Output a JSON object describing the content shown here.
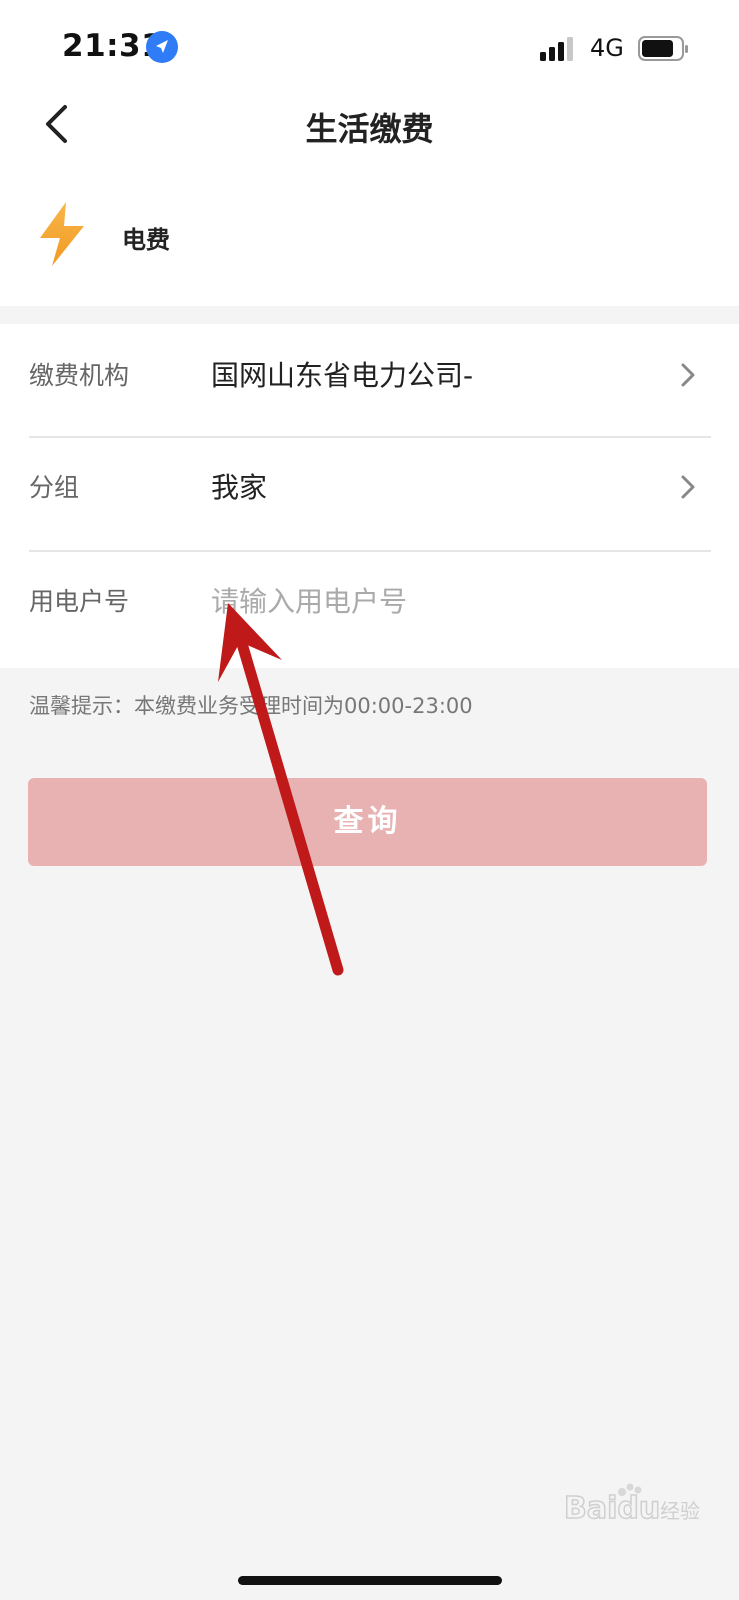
{
  "status_bar": {
    "time": "21:31",
    "network": "4G",
    "icons": [
      "location-arrow-icon",
      "signal-icon",
      "battery-icon"
    ]
  },
  "nav": {
    "title": "生活缴费",
    "back_icon": "chevron-left-icon"
  },
  "service": {
    "icon": "lightning-bolt-icon",
    "name": "电费"
  },
  "form": {
    "rows": [
      {
        "label": "缴费机构",
        "value": "国网山东省电力公司-"
      },
      {
        "label": "分组",
        "value": "我家"
      },
      {
        "label": "用电户号",
        "placeholder": "请输入用电户号"
      }
    ]
  },
  "tip": "温馨提示：本缴费业务受理时间为00:00-23:00",
  "query_button": {
    "label": "查询",
    "color": "#e8b2b3"
  },
  "watermark_text": "Baidu 经验",
  "colors": {
    "accent_orange": "#f5a623",
    "arrow_red": "#c0191a",
    "location_blue": "#2f7cf6"
  }
}
